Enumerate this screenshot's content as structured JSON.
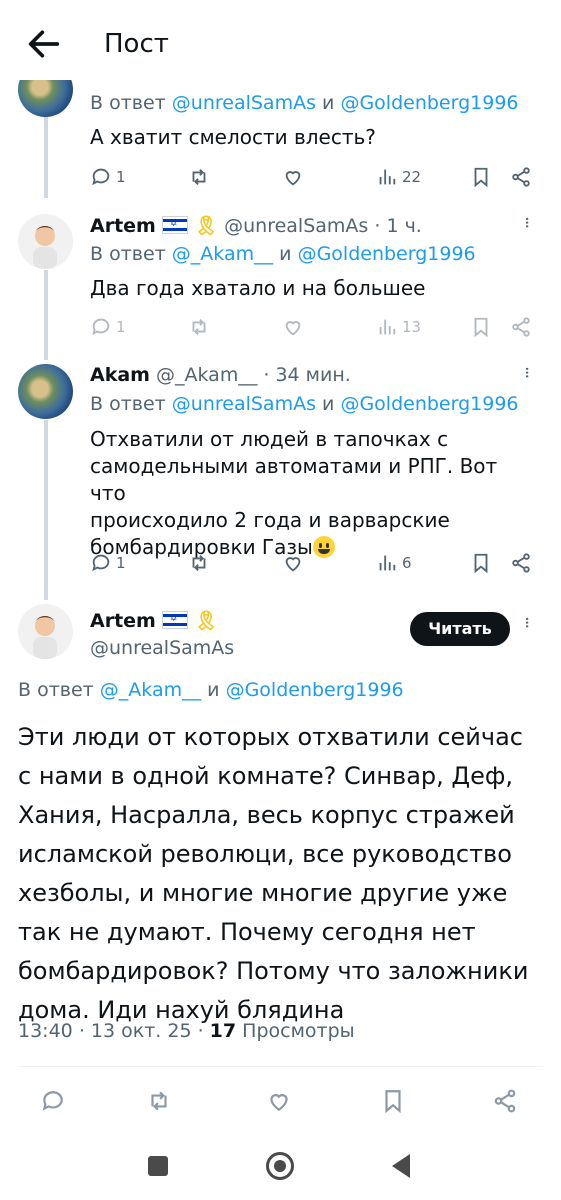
{
  "header": {
    "title": "Пост"
  },
  "replies": [
    {
      "reply_prefix": "В ответ",
      "mention1": "@unrealSamAs",
      "and": "и",
      "mention2": "@Goldenberg1996",
      "text": "А хватит смелости влесть?",
      "stats": {
        "replies": "1",
        "views": "22"
      }
    },
    {
      "name": "Artem",
      "handle": "@unrealSamAs",
      "time": "· 1 ч.",
      "reply_prefix": "В ответ",
      "mention1": "@_Akam__",
      "and": "и",
      "mention2": "@Goldenberg1996",
      "text": "Два года хватало и на большее",
      "stats": {
        "replies": "1",
        "views": "13"
      }
    },
    {
      "name": "Akam",
      "handle": "@_Akam__",
      "time": "· 34 мин.",
      "reply_prefix": "В ответ",
      "mention1": "@unrealSamAs",
      "and": "и",
      "mention2": "@Goldenberg1996",
      "text_lines": [
        "Отхватили от людей в тапочках с",
        "самодельными автоматами и РПГ. Вот что",
        "происходило 2 года и варварские",
        "бомбардировки Газы"
      ],
      "stats": {
        "replies": "1",
        "views": "6"
      }
    }
  ],
  "main_post": {
    "name": "Artem",
    "handle": "@unrealSamAs",
    "follow_label": "Читать",
    "reply_prefix": "В ответ",
    "mention1": "@_Akam__",
    "and": "и",
    "mention2": "@Goldenberg1996",
    "text_lines": [
      "Эти люди от которых отхватили сейчас",
      "с нами в одной комнате? Синвар, Деф,",
      "Хания, Насралла, весь корпус стражей",
      "исламской революци, все руководство",
      "хезболы, и многие многие другие уже",
      "так не думают. Почему сегодня нет",
      "бомбардировок? Потому что заложники",
      "дома. Иди нахуй блядина"
    ],
    "time": "13:40",
    "date": "· 13 окт. 25 ·",
    "views_count": "17",
    "views_label": "Просмотры"
  },
  "colors": {
    "link": "#1d9bf0",
    "text": "#0f1419",
    "secondary": "#536471",
    "button_bg": "#0f1419"
  }
}
